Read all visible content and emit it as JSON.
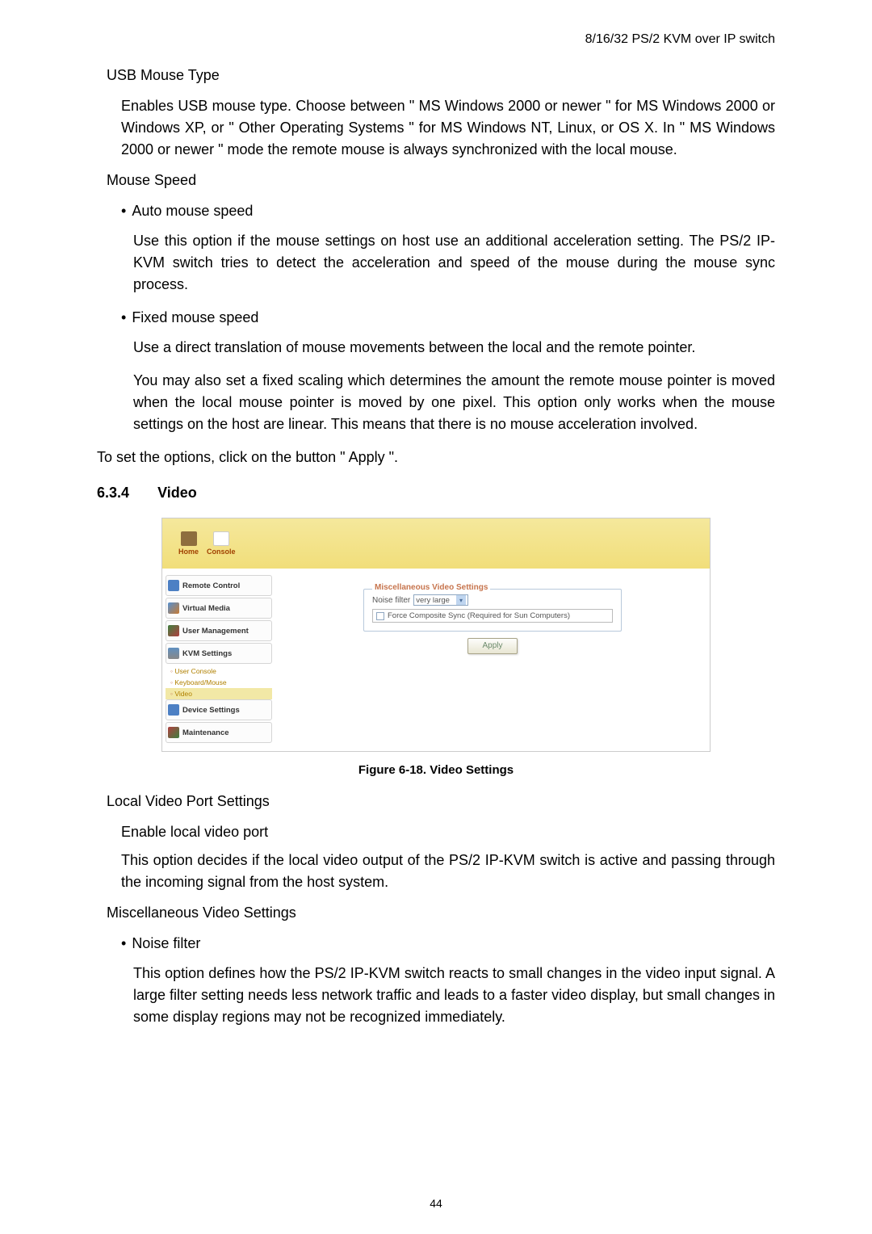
{
  "header": "8/16/32 PS/2 KVM over IP switch",
  "usb_mouse": {
    "title": "USB Mouse Type",
    "body": "Enables USB mouse type. Choose between \" MS Windows 2000 or newer \" for MS Windows 2000 or Windows XP, or \" Other Operating Systems \" for MS Windows NT, Linux, or OS X. In \" MS Windows 2000 or newer \" mode the remote mouse is always synchronized with the local mouse."
  },
  "mouse_speed": {
    "title": "Mouse Speed",
    "auto": {
      "label": "Auto mouse speed",
      "body": "Use this option if the mouse settings on host use an additional acceleration setting. The PS/2 IP-KVM switch tries to detect the acceleration and speed of the mouse during the mouse sync process."
    },
    "fixed": {
      "label": "Fixed mouse speed",
      "body1": "Use a direct translation of mouse movements between the local and the remote pointer.",
      "body2": "You may also set a fixed scaling which determines the amount the remote mouse pointer is moved when the local mouse pointer is moved by one pixel. This option only works when the mouse settings on the host are linear. This means that there is no mouse acceleration involved."
    }
  },
  "apply_line": "To set the options, click on the button \" Apply \".",
  "section": {
    "number": "6.3.4",
    "title": "Video"
  },
  "screenshot": {
    "tabs": {
      "home": "Home",
      "console": "Console"
    },
    "nav": {
      "remote": "Remote Control",
      "media": "Virtual Media",
      "user": "User Management",
      "kvm": "KVM Settings",
      "subs": {
        "user_console": "User Console",
        "keyboard": "Keyboard/Mouse",
        "video": "Video"
      },
      "device": "Device Settings",
      "maintenance": "Maintenance"
    },
    "fieldset": {
      "legend": "Miscellaneous Video Settings",
      "noise_label": "Noise filter",
      "noise_value": "very large",
      "checkbox_label": "Force Composite Sync (Required for Sun Computers)",
      "apply": "Apply"
    }
  },
  "figure_caption": "Figure 6-18. Video Settings",
  "local_video": {
    "title": "Local Video Port Settings",
    "sub": "Enable local video port",
    "body": "This option decides if the local video output of the PS/2 IP-KVM switch is active and passing through the incoming signal from the host system."
  },
  "misc_video": {
    "title": "Miscellaneous Video Settings",
    "noise": {
      "label": "Noise filter",
      "body": "This option defines how the PS/2 IP-KVM switch reacts to small changes in the video input signal. A large filter setting needs less network traffic and leads to a faster video display, but small changes in some display regions may not be recognized immediately."
    }
  },
  "page_number": "44"
}
